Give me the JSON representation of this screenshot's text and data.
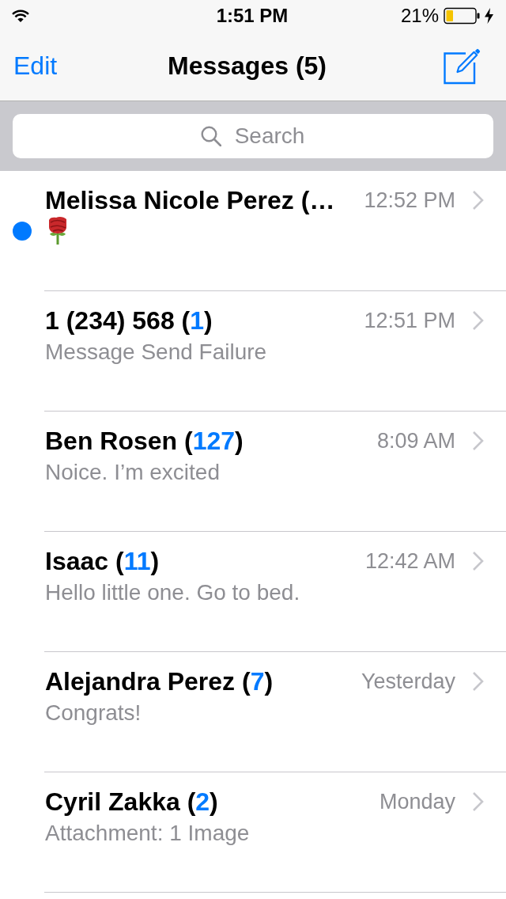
{
  "status_bar": {
    "time": "1:51 PM",
    "battery_percent": "21%",
    "charging": true
  },
  "nav_bar": {
    "edit": "Edit",
    "title": "Messages (5)"
  },
  "search": {
    "placeholder": "Search"
  },
  "conversations": [
    {
      "kind": "emoji",
      "unread": true,
      "title": [
        {
          "text": "Melissa Nicole Perez (…",
          "kind": "name"
        }
      ],
      "time": "12:52 PM"
    },
    {
      "kind": "text",
      "unread": false,
      "title": [
        {
          "text": "1 (234) 568 (",
          "kind": "name"
        },
        {
          "text": "1",
          "kind": "count"
        },
        {
          "text": ")",
          "kind": "name"
        }
      ],
      "time": "12:51 PM",
      "preview": "Message Send Failure"
    },
    {
      "kind": "text",
      "unread": false,
      "title": [
        {
          "text": "Ben Rosen (",
          "kind": "name"
        },
        {
          "text": "127",
          "kind": "count"
        },
        {
          "text": ")",
          "kind": "name"
        }
      ],
      "time": "8:09 AM",
      "preview": "Noice. I’m excited"
    },
    {
      "kind": "text",
      "unread": false,
      "title": [
        {
          "text": "Isaac (",
          "kind": "name"
        },
        {
          "text": "11",
          "kind": "count"
        },
        {
          "text": ")",
          "kind": "name"
        }
      ],
      "time": "12:42 AM",
      "preview": "Hello little one. Go to bed."
    },
    {
      "kind": "text",
      "unread": false,
      "title": [
        {
          "text": "Alejandra Perez (",
          "kind": "name"
        },
        {
          "text": "7",
          "kind": "count"
        },
        {
          "text": ")",
          "kind": "name"
        }
      ],
      "time": "Yesterday",
      "preview": "Congrats!"
    },
    {
      "kind": "text",
      "unread": false,
      "title": [
        {
          "text": "Cyril Zakka (",
          "kind": "name"
        },
        {
          "text": "2",
          "kind": "count"
        },
        {
          "text": ")",
          "kind": "name"
        }
      ],
      "time": "Monday",
      "preview": "Attachment: 1 Image"
    }
  ]
}
